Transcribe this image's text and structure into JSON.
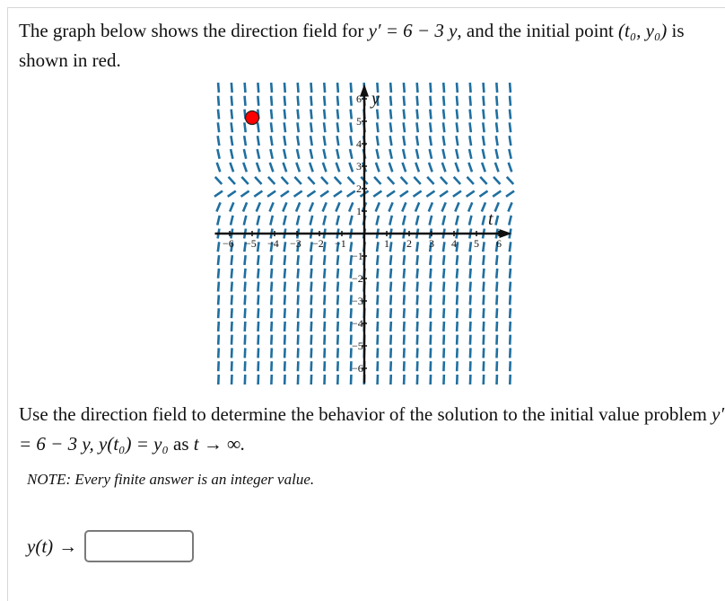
{
  "intro": {
    "text_before": "The graph below shows the direction field for ",
    "equation": "y′ = 6 − 3 y",
    "text_after": ", and the initial point ",
    "point": "(t₀, y₀)",
    "text_end": " is shown in red."
  },
  "question": {
    "text_before": "Use the direction field to determine the behavior of the solution to the initial value problem ",
    "equation": "y′ = 6 − 3 y, y(t₀) = y₀",
    "text_mid": " as ",
    "limit": "t → ∞."
  },
  "note": "NOTE: Every finite answer is an integer value.",
  "answer": {
    "label": "y(t)",
    "arrow": "→",
    "value": "",
    "placeholder": ""
  },
  "chart_data": {
    "type": "direction-field",
    "title": "",
    "equation": "y' = 6 - 3y",
    "xlabel": "t",
    "ylabel": "y",
    "xlim": [
      -6.5,
      6.5
    ],
    "ylim": [
      -6.5,
      6.5
    ],
    "x_ticks": [
      -6,
      -5,
      -4,
      -3,
      -2,
      -1,
      1,
      2,
      3,
      4,
      5,
      6
    ],
    "y_ticks": [
      -6,
      -5,
      -4,
      -3,
      -2,
      -1,
      1,
      2,
      3,
      4,
      5,
      6
    ],
    "x_tick_labels": [
      "−6",
      "−5",
      "−4",
      "−3",
      "−2",
      "−1",
      "1",
      "2",
      "3",
      "4",
      "5",
      "6"
    ],
    "y_tick_labels": [
      "−6",
      "−5",
      "−4",
      "−3",
      "−2",
      "−1",
      "1",
      "2",
      "3",
      "4",
      "5",
      "6"
    ],
    "grid": false,
    "field_grid_count": 23,
    "slope_color": "#1f6fa0",
    "initial_point": {
      "t": -5,
      "y": 5,
      "color": "#ff0000"
    }
  }
}
